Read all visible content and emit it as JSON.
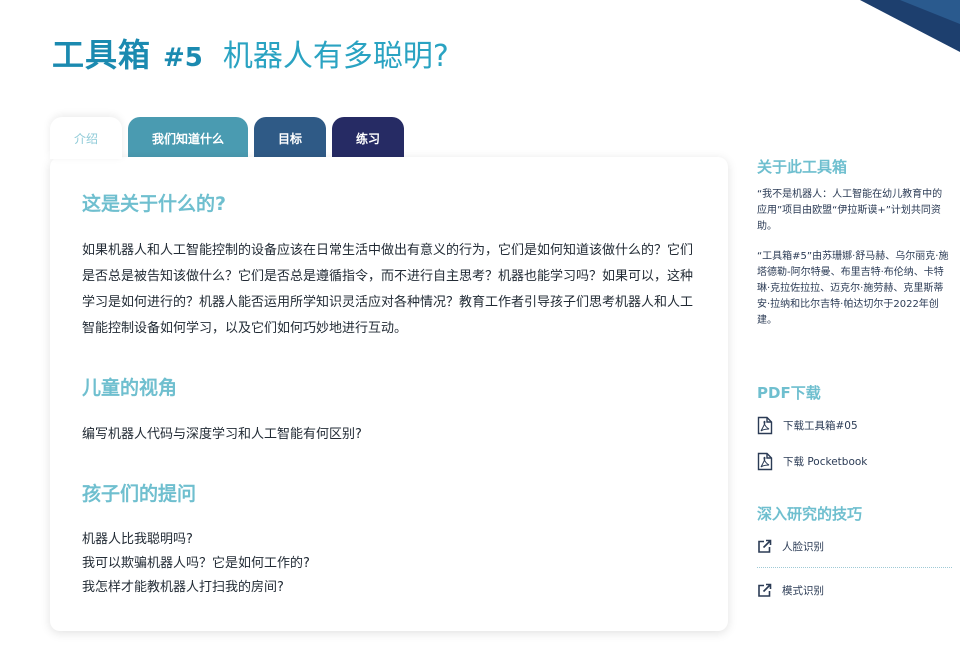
{
  "header": {
    "title_main": "工具箱",
    "title_num": "#5",
    "title_sub": "机器人有多聪明?"
  },
  "tabs": [
    {
      "label": "介绍",
      "active": true
    },
    {
      "label": "我们知道什么",
      "active": false
    },
    {
      "label": "目标",
      "active": false
    },
    {
      "label": "练习",
      "active": false
    }
  ],
  "main": {
    "sections": [
      {
        "heading": "这是关于什么的?",
        "body": "如果机器人和人工智能控制的设备应该在日常生活中做出有意义的行为，它们是如何知道该做什么的？它们是否总是被告知该做什么？它们是否总是遵循指令，而不进行自主思考？机器也能学习吗？如果可以，这种学习是如何进行的？机器人能否运用所学知识灵活应对各种情况？教育工作者引导孩子们思考机器人和人工智能控制设备如何学习，以及它们如何巧妙地进行互动。"
      },
      {
        "heading": "儿童的视角",
        "body": "编写机器人代码与深度学习和人工智能有何区别?"
      },
      {
        "heading": "孩子们的提问",
        "questions": [
          "机器人比我聪明吗?",
          "我可以欺骗机器人吗？它是如何工作的?",
          "我怎样才能教机器人打扫我的房间?"
        ]
      }
    ]
  },
  "sidebar": {
    "about": {
      "heading": "关于此工具箱",
      "paragraphs": [
        "“我不是机器人：人工智能在幼儿教育中的应用”项目由欧盟“伊拉斯谟+”计划共同资助。",
        "“工具箱#5”由苏珊娜·舒马赫、乌尔丽克·施塔德勒-阿尔特曼、布里吉特·布伦纳、卡特琳·克拉佐拉拉、迈克尔·施劳赫、克里斯蒂安·拉纳和比尔吉特·帕达切尔于2022年创建。"
      ]
    },
    "pdf": {
      "heading": "PDF下载",
      "items": [
        {
          "label": "下载工具箱#05",
          "icon": "pdf-file-icon"
        },
        {
          "label": "下载 Pocketbook",
          "icon": "pdf-file-icon"
        }
      ]
    },
    "deep": {
      "heading": "深入研究的技巧",
      "items": [
        {
          "label": "人脸识别",
          "icon": "external-link-icon"
        },
        {
          "label": "模式识别",
          "icon": "external-link-icon"
        }
      ]
    }
  },
  "colors": {
    "title": "#1b8ab0",
    "heading": "#6fbfcf",
    "tab_know": "#4a9bb1",
    "tab_goal": "#2f5a86",
    "tab_practice": "#262b64",
    "corner": "#1d3f6e"
  }
}
